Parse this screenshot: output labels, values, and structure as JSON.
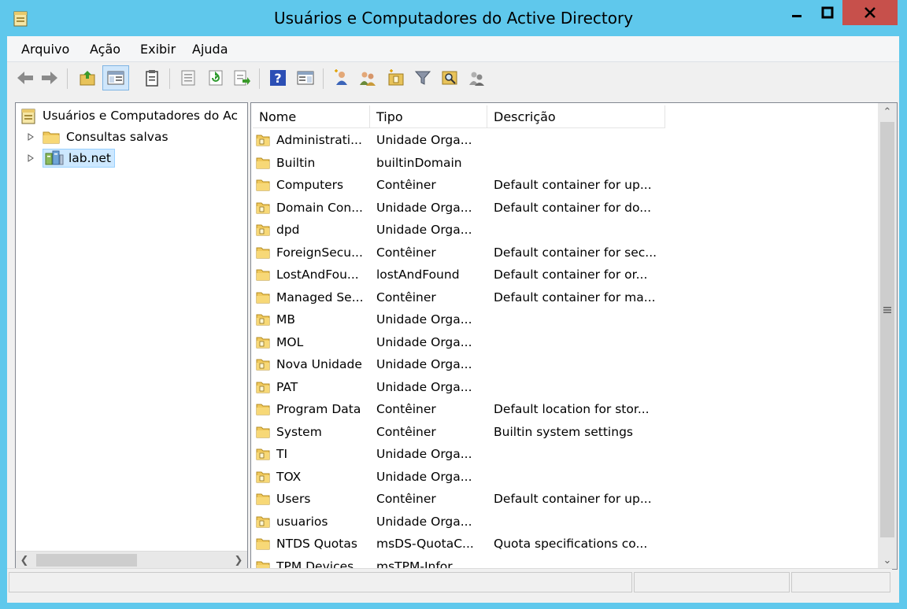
{
  "window": {
    "title": "Usuários e Computadores do Active Directory",
    "controls": {
      "minimize": "minimize-icon",
      "maximize": "maximize-icon",
      "close": "close-icon"
    }
  },
  "menu": [
    "Arquivo",
    "Ação",
    "Exibir",
    "Ajuda"
  ],
  "toolbar": {
    "buttons": [
      "back-icon",
      "forward-icon",
      "up-folder-icon",
      "show-hide-console-tree-icon",
      "clipboard-icon",
      "properties-icon",
      "refresh-icon",
      "export-list-icon",
      "help-icon",
      "action-pane-icon",
      "new-user-icon",
      "new-group-icon",
      "new-ou-icon",
      "filter-icon",
      "find-icon",
      "delegate-icon"
    ]
  },
  "tree": {
    "root": "Usuários e Computadores do Ac",
    "items": [
      {
        "label": "Consultas salvas",
        "icon": "folder-icon"
      },
      {
        "label": "lab.net",
        "icon": "domain-icon"
      }
    ]
  },
  "list": {
    "columns": [
      "Nome",
      "Tipo",
      "Descrição"
    ],
    "rows": [
      {
        "name": "Administrati...",
        "type": "Unidade Orga...",
        "desc": "",
        "icon": "ou"
      },
      {
        "name": "Builtin",
        "type": "builtinDomain",
        "desc": "",
        "icon": "folder"
      },
      {
        "name": "Computers",
        "type": "Contêiner",
        "desc": "Default container for up...",
        "icon": "folder"
      },
      {
        "name": "Domain Con...",
        "type": "Unidade Orga...",
        "desc": "Default container for do...",
        "icon": "ou"
      },
      {
        "name": "dpd",
        "type": "Unidade Orga...",
        "desc": "",
        "icon": "ou"
      },
      {
        "name": "ForeignSecu...",
        "type": "Contêiner",
        "desc": "Default container for sec...",
        "icon": "folder"
      },
      {
        "name": "LostAndFou...",
        "type": "lostAndFound",
        "desc": "Default container for or...",
        "icon": "folder"
      },
      {
        "name": "Managed Se...",
        "type": "Contêiner",
        "desc": "Default container for ma...",
        "icon": "folder"
      },
      {
        "name": "MB",
        "type": "Unidade Orga...",
        "desc": "",
        "icon": "ou"
      },
      {
        "name": "MOL",
        "type": "Unidade Orga...",
        "desc": "",
        "icon": "ou"
      },
      {
        "name": "Nova Unidade",
        "type": "Unidade Orga...",
        "desc": "",
        "icon": "ou"
      },
      {
        "name": "PAT",
        "type": "Unidade Orga...",
        "desc": "",
        "icon": "ou"
      },
      {
        "name": "Program Data",
        "type": "Contêiner",
        "desc": "Default location for stor...",
        "icon": "folder"
      },
      {
        "name": "System",
        "type": "Contêiner",
        "desc": "Builtin system settings",
        "icon": "folder"
      },
      {
        "name": "TI",
        "type": "Unidade Orga...",
        "desc": "",
        "icon": "ou"
      },
      {
        "name": "TOX",
        "type": "Unidade Orga...",
        "desc": "",
        "icon": "ou"
      },
      {
        "name": "Users",
        "type": "Contêiner",
        "desc": "Default container for up...",
        "icon": "folder"
      },
      {
        "name": "usuarios",
        "type": "Unidade Orga...",
        "desc": "",
        "icon": "ou"
      },
      {
        "name": "NTDS Quotas",
        "type": "msDS-QuotaC...",
        "desc": "Quota specifications co...",
        "icon": "folder"
      },
      {
        "name": "TPM Devices",
        "type": "msTPM-Infor...",
        "desc": "",
        "icon": "folder"
      }
    ]
  },
  "colors": {
    "frame": "#5fc8ec",
    "close_button": "#c7504b",
    "selection": "#cde8ff"
  }
}
